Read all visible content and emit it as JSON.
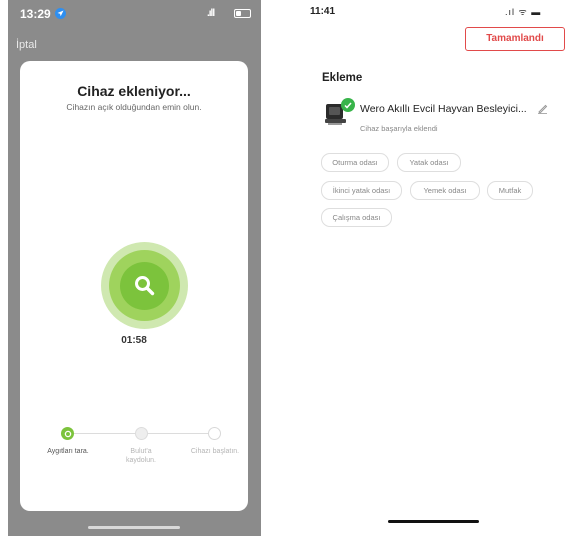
{
  "left_screen": {
    "status": {
      "time": "13:29",
      "signal": ".ıll"
    },
    "cancel_label": "İptal",
    "card": {
      "title": "Cihaz ekleniyor...",
      "subtitle": "Cihazın açık olduğundan emin olun.",
      "timer": "01:58"
    },
    "steps": [
      {
        "label": "Aygıtları tara.",
        "state": "active"
      },
      {
        "label": "Bulut'a kaydolun.",
        "state": "pending"
      },
      {
        "label": "Cihazı başlatın.",
        "state": "pending"
      }
    ],
    "colors": {
      "accent": "#7cc33c",
      "location": "#2f8ff0"
    }
  },
  "right_screen": {
    "status": {
      "time": "11:41",
      "icons": ".ıl ᯤ ▬"
    },
    "done_button": "Tamamlandı",
    "section_title": "Ekleme",
    "device": {
      "name": "Wero Akıllı Evcil Hayvan Besleyici...",
      "status": "Cihaz başarıyla eklendi"
    },
    "rooms": [
      "Oturma odası",
      "Yatak odası",
      "İkinci yatak odası",
      "Yemek odası",
      "Mutfak",
      "Çalışma odası"
    ],
    "colors": {
      "done": "#e14a4a",
      "check": "#38b44a"
    }
  }
}
